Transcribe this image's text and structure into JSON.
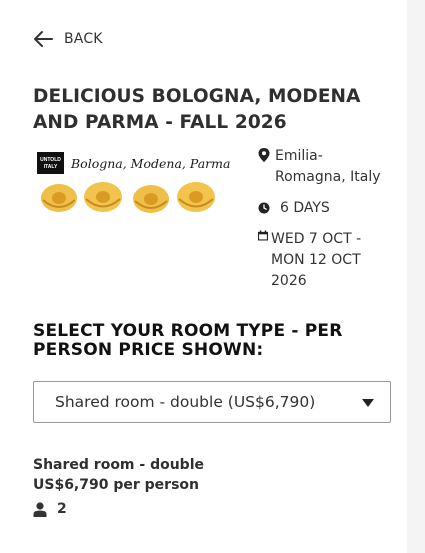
{
  "nav": {
    "back_label": "BACK",
    "back_icon": "arrow-left-icon"
  },
  "tour": {
    "title": "DELICIOUS BOLOGNA, MODENA AND PARMA - FALL 2026",
    "banner": {
      "logo_text_line1": "UNTOLD",
      "logo_text_line2": "ITALY",
      "script_text": "Bologna, Modena, Parma"
    },
    "location_icon": "map-pin-icon",
    "location_line1": "Emilia-",
    "location_line2": "Romagna, Italy",
    "duration_icon": "clock-icon",
    "duration": "6 DAYS",
    "dates_icon": "calendar-icon",
    "dates_line1": "WED 7 OCT -",
    "dates_line2": "MON 12 OCT",
    "dates_line3": "2026"
  },
  "room": {
    "section_title": "SELECT YOUR ROOM TYPE - PER PERSON PRICE SHOWN:",
    "selected_option": "Shared room - double (US$6,790)",
    "summary_name": "Shared room - double",
    "summary_price": "US$6,790 per person",
    "guests_icon": "person-icon",
    "guests": "2"
  },
  "colors": {
    "text": "#2f2f2f",
    "pasta": "#f0c24a",
    "border": "#9a9a9a"
  }
}
